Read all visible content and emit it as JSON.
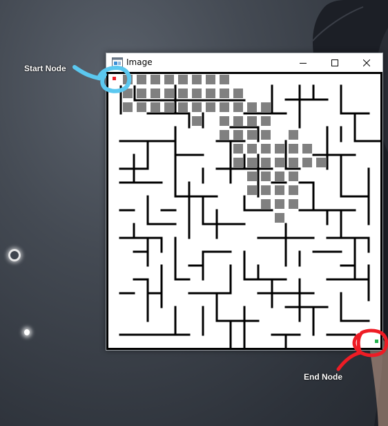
{
  "window": {
    "title": "Image",
    "icon": "image-app-icon",
    "controls": {
      "minimize": "minimize-icon",
      "maximize": "maximize-icon",
      "close": "close-icon"
    }
  },
  "annotations": {
    "start_label": "Start Node",
    "end_label": "End Node",
    "start_color": "#5bc8f0",
    "end_color": "#ee1c25"
  },
  "maze": {
    "cols": 20,
    "rows": 20,
    "wall_color": "#000000",
    "path_color": "#808080",
    "start_color": "#ee1c25",
    "end_color": "#22b14c",
    "start": [
      0,
      0
    ],
    "end": [
      19,
      19
    ],
    "path": [
      [
        1,
        0
      ],
      [
        2,
        0
      ],
      [
        3,
        0
      ],
      [
        4,
        0
      ],
      [
        5,
        0
      ],
      [
        6,
        0
      ],
      [
        7,
        0
      ],
      [
        8,
        0
      ],
      [
        1,
        1
      ],
      [
        2,
        1
      ],
      [
        3,
        1
      ],
      [
        4,
        1
      ],
      [
        5,
        1
      ],
      [
        6,
        1
      ],
      [
        7,
        1
      ],
      [
        8,
        1
      ],
      [
        9,
        1
      ],
      [
        1,
        2
      ],
      [
        2,
        2
      ],
      [
        3,
        2
      ],
      [
        4,
        2
      ],
      [
        5,
        2
      ],
      [
        6,
        2
      ],
      [
        7,
        2
      ],
      [
        8,
        2
      ],
      [
        9,
        2
      ],
      [
        10,
        2
      ],
      [
        11,
        2
      ],
      [
        6,
        3
      ],
      [
        8,
        3
      ],
      [
        9,
        3
      ],
      [
        10,
        3
      ],
      [
        11,
        3
      ],
      [
        8,
        4
      ],
      [
        9,
        4
      ],
      [
        10,
        4
      ],
      [
        11,
        4
      ],
      [
        13,
        4
      ],
      [
        9,
        5
      ],
      [
        10,
        5
      ],
      [
        11,
        5
      ],
      [
        12,
        5
      ],
      [
        13,
        5
      ],
      [
        14,
        5
      ],
      [
        9,
        6
      ],
      [
        10,
        6
      ],
      [
        11,
        6
      ],
      [
        12,
        6
      ],
      [
        13,
        6
      ],
      [
        14,
        6
      ],
      [
        15,
        6
      ],
      [
        10,
        7
      ],
      [
        11,
        7
      ],
      [
        12,
        7
      ],
      [
        13,
        7
      ],
      [
        10,
        8
      ],
      [
        11,
        8
      ],
      [
        12,
        8
      ],
      [
        13,
        8
      ],
      [
        11,
        9
      ],
      [
        12,
        9
      ],
      [
        13,
        9
      ],
      [
        12,
        10
      ]
    ]
  }
}
